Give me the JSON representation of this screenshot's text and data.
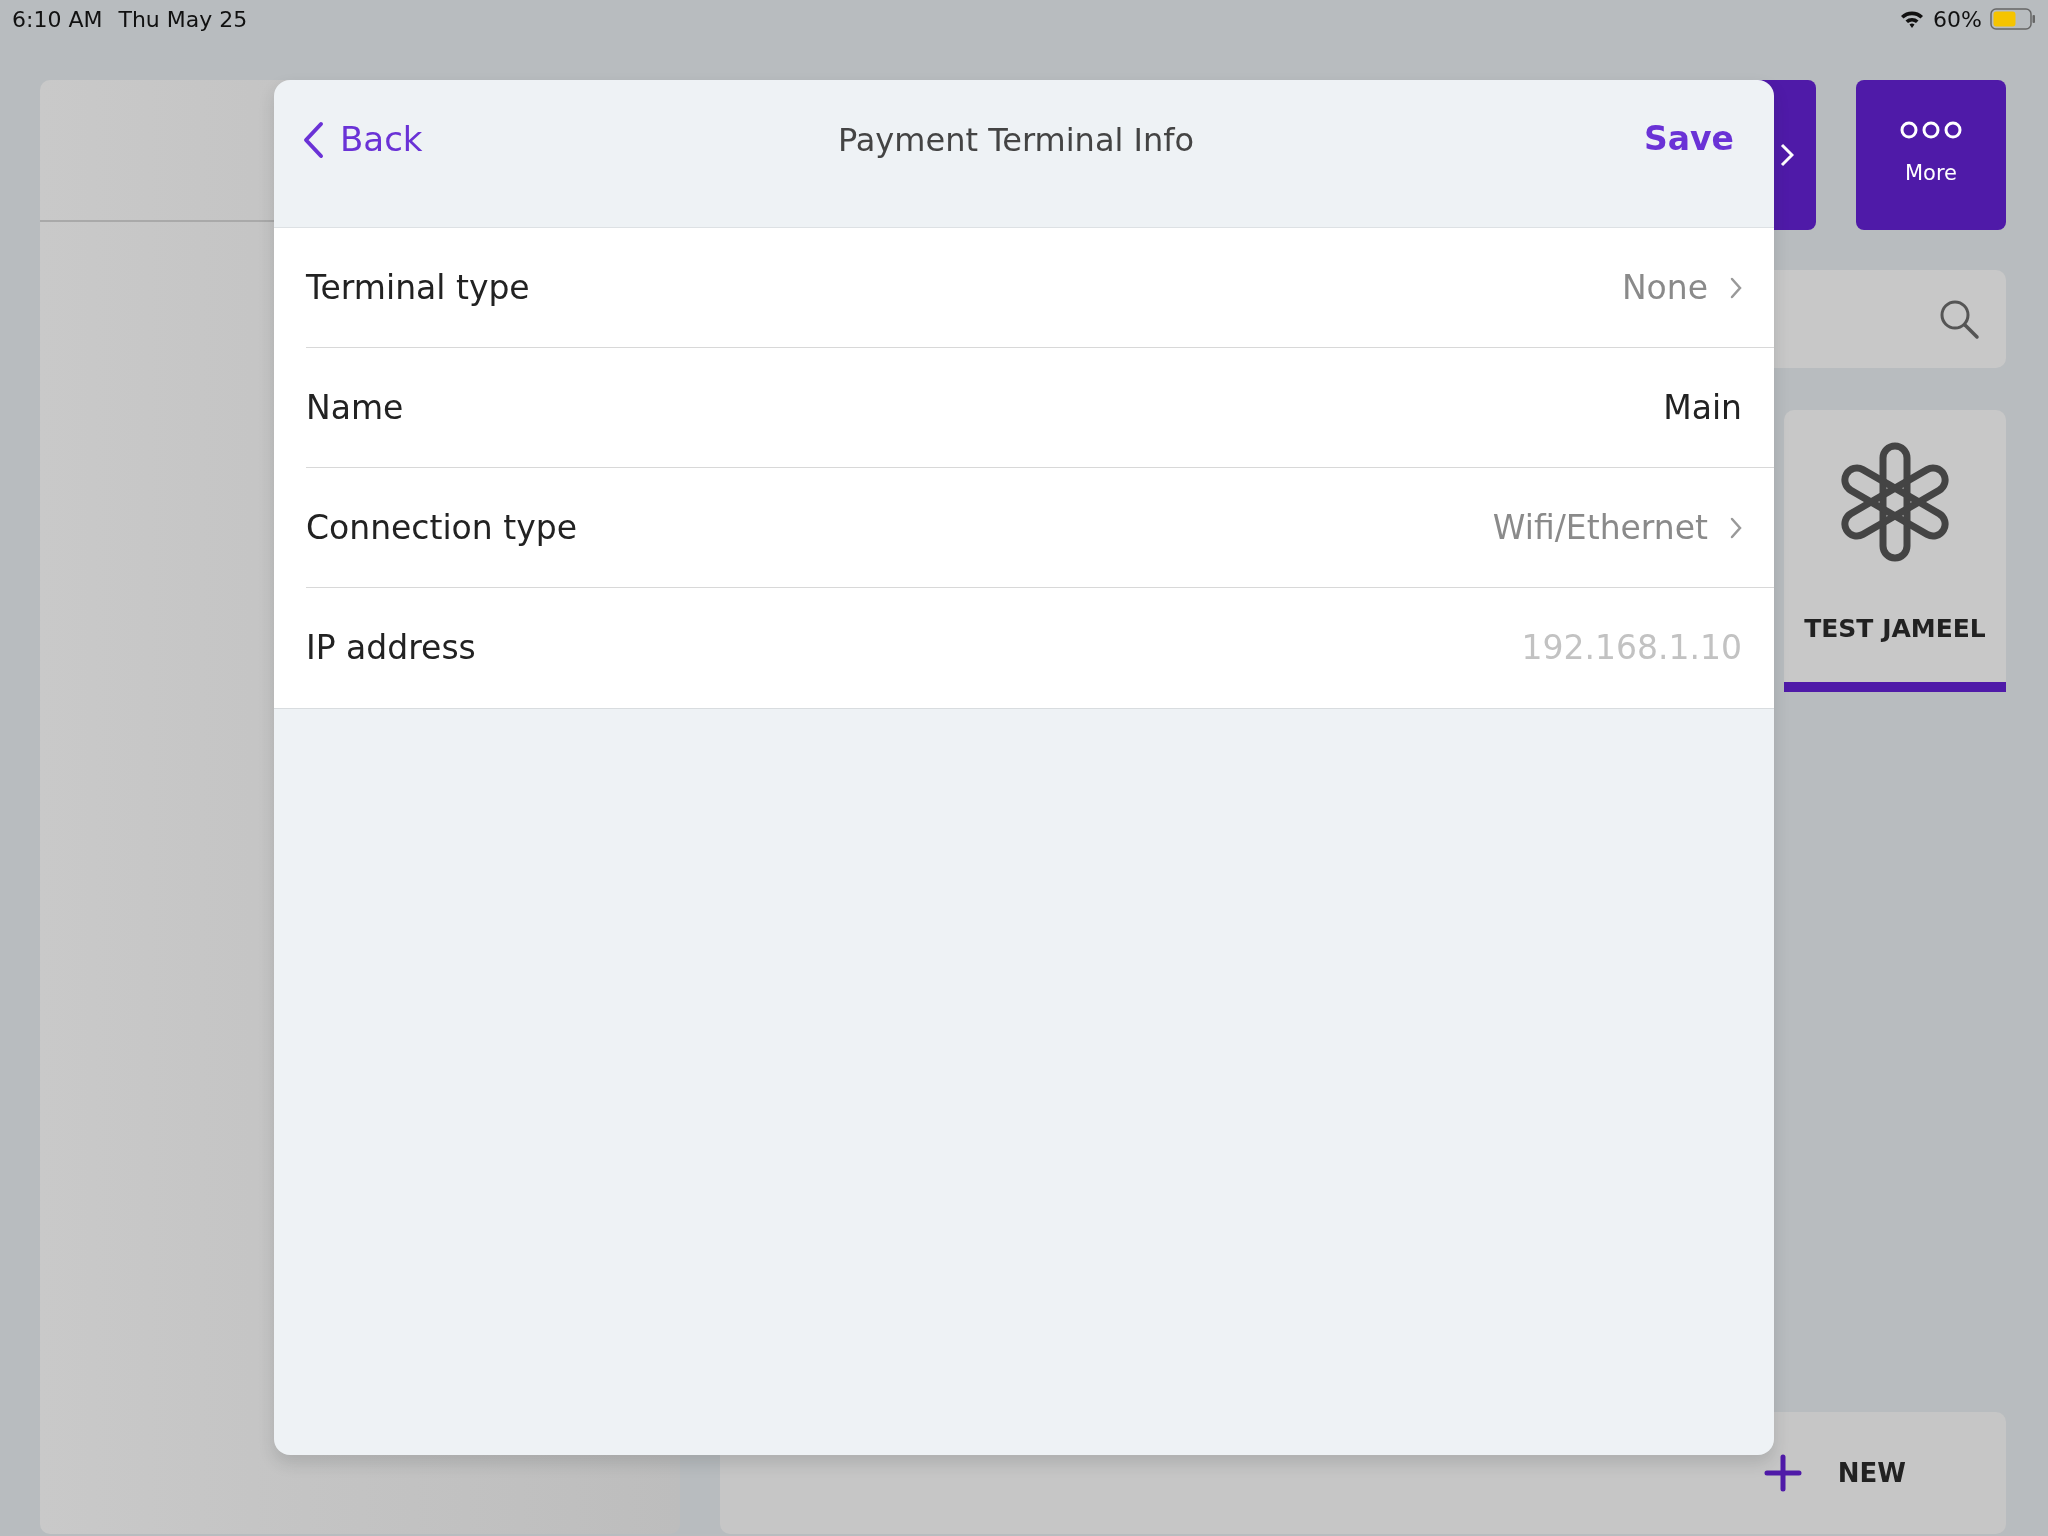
{
  "status_bar": {
    "time": "6:10 AM",
    "date": "Thu May 25",
    "battery": "60%"
  },
  "background": {
    "more_button": {
      "label": "More"
    },
    "item_card": {
      "label": "TEST JAMEEL",
      "selected": true
    },
    "new_button": {
      "label": "NEW"
    }
  },
  "modal": {
    "back": "Back",
    "title": "Payment Terminal Info",
    "save": "Save"
  },
  "fields": [
    {
      "kind": "picker",
      "label": "Terminal type",
      "value": "None"
    },
    {
      "kind": "text",
      "label": "Name",
      "value": "Main"
    },
    {
      "kind": "picker",
      "label": "Connection type",
      "value": "Wifi/Ethernet"
    },
    {
      "kind": "text",
      "label": "IP address",
      "placeholder": "192.168.1.10"
    }
  ]
}
